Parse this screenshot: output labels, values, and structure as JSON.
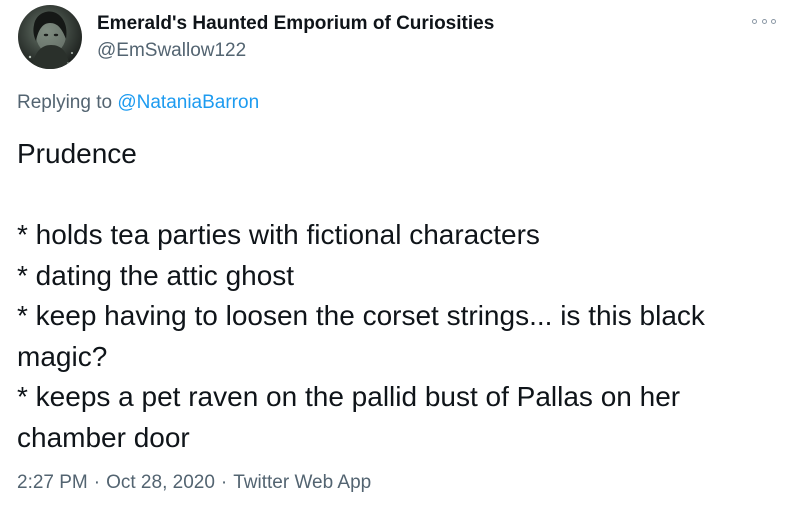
{
  "tweet": {
    "display_name": "Emerald's Haunted Emporium of Curiosities",
    "handle": "@EmSwallow122",
    "replying_prefix": "Replying to",
    "replying_to": "@NataniaBarron",
    "body_lines": [
      "Prudence",
      "",
      "* holds tea parties with fictional characters",
      "* dating the attic ghost",
      "* keep having to loosen the corset strings... is this black",
      "magic?",
      "* keeps a pet raven on the pallid bust of Pallas on her",
      "chamber door"
    ],
    "time": "2:27 PM",
    "date": "Oct 28, 2020",
    "source": "Twitter Web App",
    "separator": "·"
  },
  "icons": {
    "avatar": "user-avatar-photo",
    "more": "more-options-icon"
  },
  "colors": {
    "text": "#0f1419",
    "secondary": "#536471",
    "link": "#1d9bf0"
  }
}
